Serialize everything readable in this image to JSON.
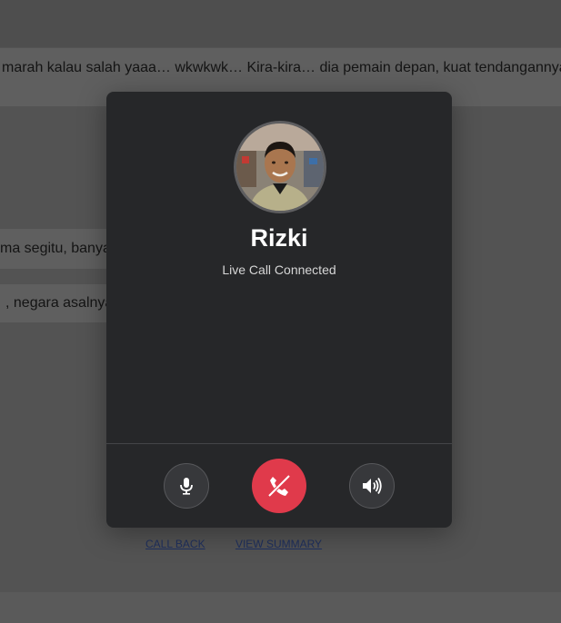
{
  "background": {
    "messages": [
      "marah kalau salah yaaa… wkwkwk… Kira-kira… dia pemain depan, kuat tendangannya, d",
      "ma segitu, banya",
      ", negara asalnya"
    ],
    "links": {
      "call_back": "CALL BACK",
      "view_summary": "VIEW SUMMARY"
    }
  },
  "call": {
    "callee_name": "Rizki",
    "status": "Live Call Connected",
    "controls": {
      "mute_icon": "microphone-icon",
      "end_icon": "phone-hangup-icon",
      "speaker_icon": "speaker-icon"
    },
    "colors": {
      "end_call": "#e03a4b",
      "panel": "#262729"
    }
  }
}
